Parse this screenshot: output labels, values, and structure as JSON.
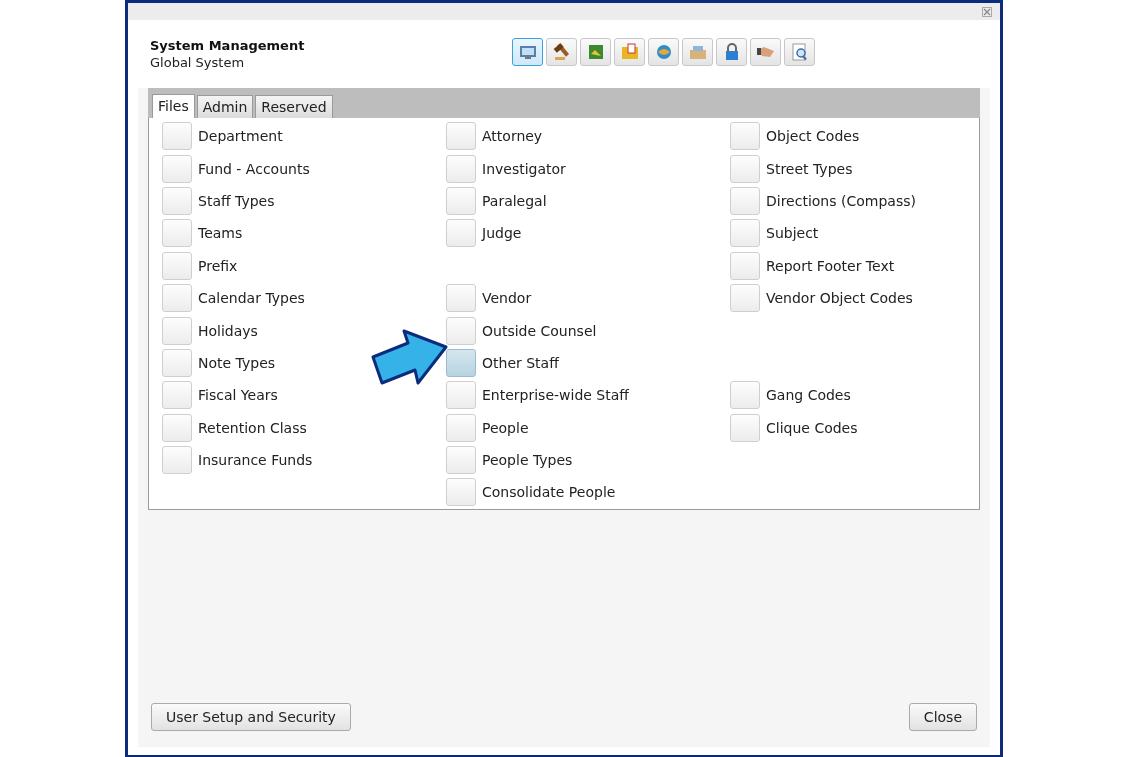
{
  "window": {
    "title": "System Management",
    "subtitle": "Global System"
  },
  "toolbar": [
    {
      "selected": true
    },
    {
      "selected": false
    },
    {
      "selected": false
    },
    {
      "selected": false
    },
    {
      "selected": false
    },
    {
      "selected": false
    },
    {
      "selected": false
    },
    {
      "selected": false
    },
    {
      "selected": false
    }
  ],
  "tabs": [
    {
      "label": "Files",
      "selected": true
    },
    {
      "label": "Admin",
      "selected": false
    },
    {
      "label": "Reserved",
      "selected": false
    }
  ],
  "columns": [
    [
      {
        "kind": "item",
        "label": "Department",
        "highlighted": false
      },
      {
        "kind": "item",
        "label": "Fund - Accounts",
        "highlighted": false
      },
      {
        "kind": "item",
        "label": "Staff Types",
        "highlighted": false
      },
      {
        "kind": "item",
        "label": "Teams",
        "highlighted": false
      },
      {
        "kind": "item",
        "label": "Prefix",
        "highlighted": false
      },
      {
        "kind": "item",
        "label": "Calendar Types",
        "highlighted": false
      },
      {
        "kind": "item",
        "label": "Holidays",
        "highlighted": false
      },
      {
        "kind": "item",
        "label": "Note Types",
        "highlighted": false
      },
      {
        "kind": "item",
        "label": "Fiscal Years",
        "highlighted": false
      },
      {
        "kind": "item",
        "label": "Retention Class",
        "highlighted": false
      },
      {
        "kind": "item",
        "label": "Insurance Funds",
        "highlighted": false
      }
    ],
    [
      {
        "kind": "item",
        "label": "Attorney",
        "highlighted": false
      },
      {
        "kind": "item",
        "label": "Investigator",
        "highlighted": false
      },
      {
        "kind": "item",
        "label": "Paralegal",
        "highlighted": false
      },
      {
        "kind": "item",
        "label": "Judge",
        "highlighted": false
      },
      {
        "kind": "gap"
      },
      {
        "kind": "item",
        "label": "Vendor",
        "highlighted": false
      },
      {
        "kind": "item",
        "label": "Outside Counsel",
        "highlighted": false
      },
      {
        "kind": "item",
        "label": "Other Staff",
        "highlighted": true,
        "pointer": true
      },
      {
        "kind": "item",
        "label": "Enterprise-wide Staff",
        "highlighted": false
      },
      {
        "kind": "item",
        "label": "People",
        "highlighted": false
      },
      {
        "kind": "item",
        "label": "People Types",
        "highlighted": false
      },
      {
        "kind": "item",
        "label": "Consolidate People",
        "highlighted": false
      }
    ],
    [
      {
        "kind": "item",
        "label": "Object Codes",
        "highlighted": false
      },
      {
        "kind": "item",
        "label": "Street Types",
        "highlighted": false
      },
      {
        "kind": "item",
        "label": "Directions (Compass)",
        "highlighted": false
      },
      {
        "kind": "item",
        "label": "Subject",
        "highlighted": false
      },
      {
        "kind": "item",
        "label": "Report Footer Text",
        "highlighted": false
      },
      {
        "kind": "item",
        "label": "Vendor Object Codes",
        "highlighted": false
      },
      {
        "kind": "gap"
      },
      {
        "kind": "gap"
      },
      {
        "kind": "item",
        "label": "Gang Codes",
        "highlighted": false
      },
      {
        "kind": "item",
        "label": "Clique Codes",
        "highlighted": false
      }
    ]
  ],
  "buttons": {
    "left": "User Setup and Security",
    "right": "Close"
  }
}
